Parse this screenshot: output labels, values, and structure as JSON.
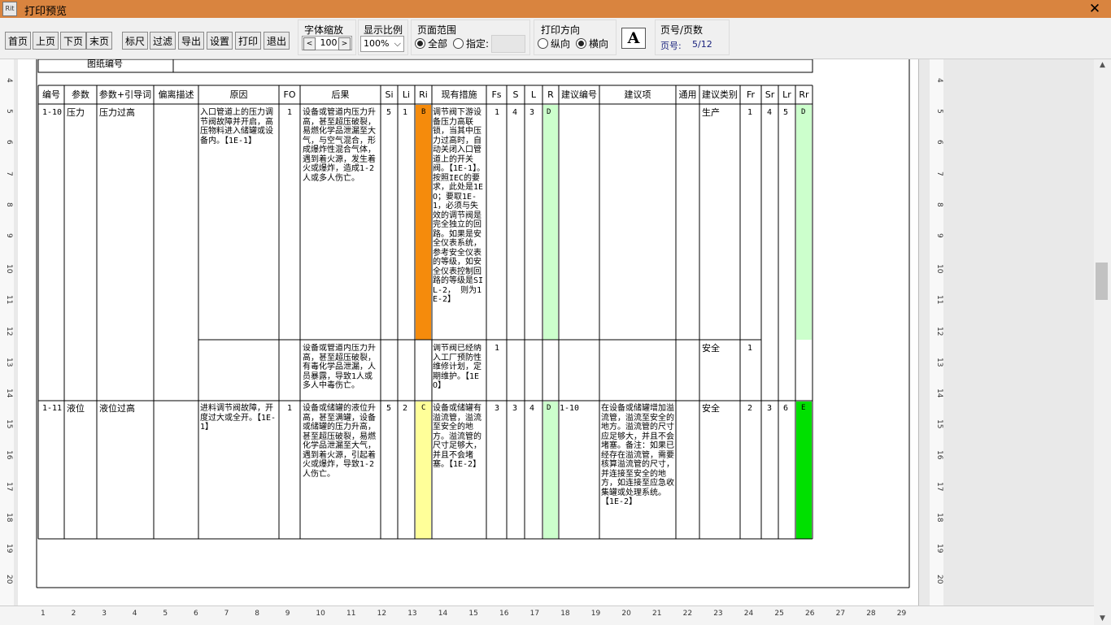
{
  "window": {
    "title": "打印预览",
    "app_icon_text": "Rit"
  },
  "toolbar": {
    "nav_buttons": [
      "首页",
      "上页",
      "下页",
      "末页"
    ],
    "action_buttons": [
      "标尺",
      "过滤",
      "导出",
      "设置",
      "打印",
      "退出"
    ],
    "font_zoom": {
      "label": "字体缩放",
      "value": "100",
      "dec": "<",
      "inc": ">"
    },
    "display_ratio": {
      "label": "显示比例",
      "value": "100%"
    },
    "page_range": {
      "label": "页面范围",
      "all": "全部",
      "specified": "指定:"
    },
    "orientation": {
      "label": "打印方向",
      "portrait": "纵向",
      "landscape": "横向"
    },
    "font_button": "A",
    "page_info": {
      "label": "页号/页数",
      "prefix": "页号:",
      "value": "5/12"
    }
  },
  "table": {
    "drawing_label": "图纸编号",
    "headers": [
      "编号",
      "参数",
      "参数+引导词",
      "偏离描述",
      "原因",
      "FO",
      "后果",
      "Si",
      "Li",
      "Ri",
      "现有措施",
      "Fs",
      "S",
      "L",
      "R",
      "建议编号",
      "建议项",
      "通用",
      "建议类别",
      "Fr",
      "Sr",
      "Lr",
      "Rr"
    ],
    "colors": {
      "orange": "#f58b0c",
      "light_green": "#ccffcc",
      "yellow": "#ffff99",
      "green": "#00e000"
    },
    "row1": {
      "id": "1-10",
      "param": "压力",
      "guideword": "压力过高",
      "deviation": "",
      "cause": "入口管道上的压力调节阀故障并开启，高压物料进入储罐或设备内。【1E-1】",
      "fo": "1",
      "consequence": "设备或管道内压力升高，甚至超压破裂，易燃化学品泄漏至大气，与空气混合，形成爆炸性混合气体，遇到着火源，发生着火或爆炸，造成1-2人或多人伤亡。",
      "si": "5",
      "li": "1",
      "ri": "B",
      "measures": "调节阀下游设备压力高联锁，当其中压力过高时，自动关闭入口管道上的开关阀。【1E-1】。按照IEC的要求，此处是1EO；要取1E-1，必须与失效的调节阀是完全独立的回路。如果是安全仪表系统，参考安全仪表的等级，如安全仪表控制回路的等级是SIL-2， 则为1E-2】",
      "fs": "1",
      "s": "4",
      "l": "3",
      "r": "D",
      "rec_no": "",
      "rec": "",
      "general": "",
      "category": "生产",
      "fr": "1",
      "sr": "4",
      "lr": "5",
      "rr": "D"
    },
    "row1b": {
      "consequence": "设备或管道内压力升高，甚至超压破裂，有毒化学品泄漏，人员暴露，导致1人或多人中毒伤亡。",
      "measures": "调节阀已经纳入工厂预防性维修计划，定期维护。【1EO】",
      "fs": "1",
      "category": "安全",
      "fr": "1"
    },
    "row2": {
      "id": "1-11",
      "param": "液位",
      "guideword": "液位过高",
      "deviation": "",
      "cause": "进料调节阀故障，开度过大或全开。【1E-1】",
      "fo": "1",
      "consequence": "设备或储罐的液位升高，甚至满罐，设备或储罐的压力升高，甚至超压破裂，易燃化学品泄漏至大气，遇到着火源，引起着火或爆炸，导致1-2人伤亡。",
      "si": "5",
      "li": "2",
      "ri": "C",
      "measures": "设备或储罐有溢流管，溢流至安全的地方。溢流管的尺寸足够大，并且不会堵塞。【1E-2】",
      "fs": "3",
      "s": "3",
      "l": "4",
      "r": "D",
      "rec_no": "1-10",
      "rec": "在设备或储罐增加溢流管，溢流至安全的地方。溢流管的尺寸应足够大，并且不会堵塞。备注：如果已经存在溢流管，需要核算溢流管的尺寸，并连接至安全的地方，如连接至应急收集罐或处理系统。【1E-2】",
      "general": "",
      "category": "安全",
      "fr": "2",
      "sr": "3",
      "lr": "6",
      "rr": "E"
    }
  },
  "rulers": {
    "vertical": [
      "4",
      "5",
      "6",
      "7",
      "8",
      "9",
      "10",
      "11",
      "12",
      "13",
      "14",
      "15",
      "16",
      "17",
      "18",
      "19",
      "20"
    ],
    "horizontal": [
      "1",
      "2",
      "3",
      "4",
      "5",
      "6",
      "7",
      "8",
      "9",
      "10",
      "11",
      "12",
      "13",
      "14",
      "15",
      "16",
      "17",
      "18",
      "19",
      "20",
      "21",
      "22",
      "23",
      "24",
      "25",
      "26",
      "27",
      "28",
      "29"
    ]
  }
}
